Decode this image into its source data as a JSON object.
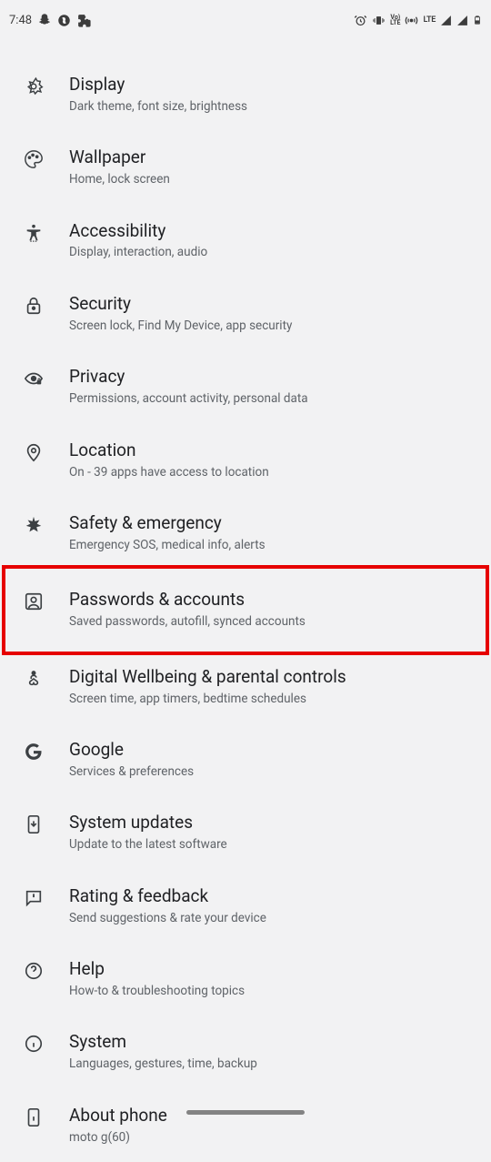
{
  "status_bar": {
    "time": "7:48",
    "lte_label": "LTE"
  },
  "settings_items": [
    {
      "id": "display",
      "title": "Display",
      "subtitle": "Dark theme, font size, brightness"
    },
    {
      "id": "wallpaper",
      "title": "Wallpaper",
      "subtitle": "Home, lock screen"
    },
    {
      "id": "accessibility",
      "title": "Accessibility",
      "subtitle": "Display, interaction, audio"
    },
    {
      "id": "security",
      "title": "Security",
      "subtitle": "Screen lock, Find My Device, app security"
    },
    {
      "id": "privacy",
      "title": "Privacy",
      "subtitle": "Permissions, account activity, personal data"
    },
    {
      "id": "location",
      "title": "Location",
      "subtitle": "On - 39 apps have access to location"
    },
    {
      "id": "safety",
      "title": "Safety & emergency",
      "subtitle": "Emergency SOS, medical info, alerts"
    },
    {
      "id": "passwords",
      "title": "Passwords & accounts",
      "subtitle": "Saved passwords, autofill, synced accounts",
      "highlighted": true
    },
    {
      "id": "wellbeing",
      "title": "Digital Wellbeing & parental controls",
      "subtitle": "Screen time, app timers, bedtime schedules"
    },
    {
      "id": "google",
      "title": "Google",
      "subtitle": "Services & preferences"
    },
    {
      "id": "updates",
      "title": "System updates",
      "subtitle": "Update to the latest software"
    },
    {
      "id": "rating",
      "title": "Rating & feedback",
      "subtitle": "Send suggestions & rate your device"
    },
    {
      "id": "help",
      "title": "Help",
      "subtitle": "How-to & troubleshooting topics"
    },
    {
      "id": "system",
      "title": "System",
      "subtitle": "Languages, gestures, time, backup"
    },
    {
      "id": "about",
      "title": "About phone",
      "subtitle": "moto g(60)"
    }
  ]
}
